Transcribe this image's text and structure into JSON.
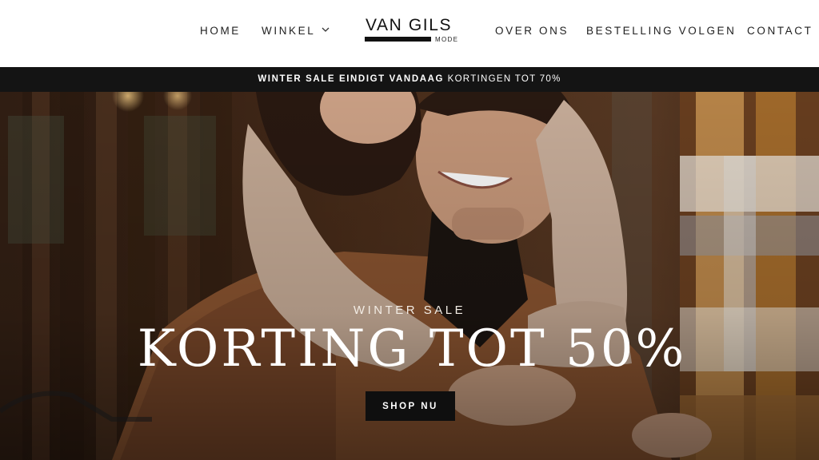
{
  "nav": {
    "home": "HOME",
    "winkel": "WINKEL",
    "over_ons": "OVER ONS",
    "bestelling": "BESTELLING VOLGEN",
    "contact": "CONTACT"
  },
  "logo": {
    "main": "VAN GILS",
    "sub": "MODE"
  },
  "promo": {
    "bold": "WINTER SALE EINDIGT VANDAAG",
    "rest": "KORTINGEN TOT 70%"
  },
  "hero": {
    "kicker": "WINTER SALE",
    "title": "KORTING TOT 50%",
    "cta": "SHOP NU"
  },
  "colors": {
    "promo_bar": "#141414",
    "button": "#0f0f0f",
    "text": "#222222"
  },
  "icons": {
    "winkel_dropdown": "chevron-down-icon"
  }
}
